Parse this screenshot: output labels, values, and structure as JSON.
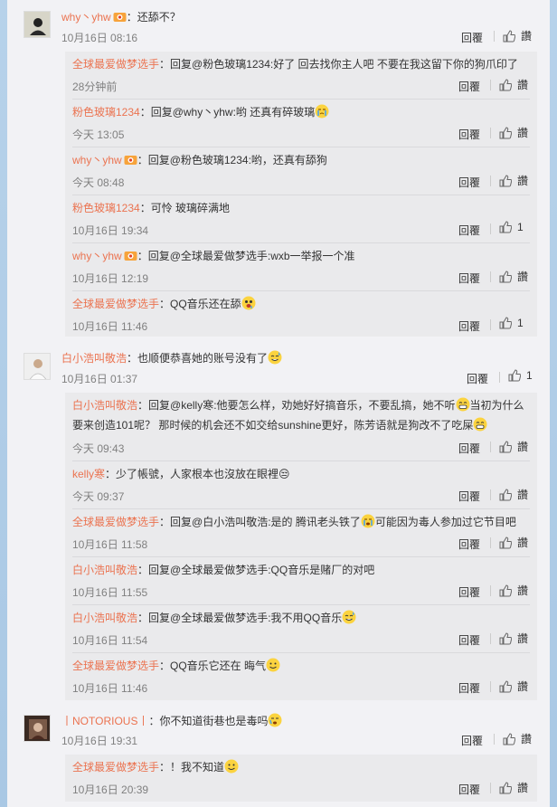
{
  "labels": {
    "reply": "回覆",
    "like": "讚"
  },
  "comments": [
    {
      "user": "why丶yhw",
      "text": "：还舔不？",
      "time": "10月16日 08:16",
      "replies": [
        {
          "user": "全球最爱做梦选手",
          "text": "：回复@粉色玻璃1234:好了 回去找你主人吧 不要在我这留下你的狗爪印了",
          "time": "28分钟前",
          "likes": ""
        },
        {
          "user": "粉色玻璃1234",
          "text": "：回复@why丶yhw:哟 还真有碎玻璃",
          "time": "今天 13:05",
          "likes": ""
        },
        {
          "user": "why丶yhw",
          "text": "：回复@粉色玻璃1234:哟，还真有舔狗",
          "time": "今天 08:48",
          "likes": ""
        },
        {
          "user": "粉色玻璃1234",
          "text": "：可怜 玻璃碎满地",
          "time": "10月16日 19:34",
          "likes": "1"
        },
        {
          "user": "why丶yhw",
          "text": "：回复@全球最爱做梦选手:wxb一举报一个准",
          "time": "10月16日 12:19",
          "likes": ""
        },
        {
          "user": "全球最爱做梦选手",
          "text": "：QQ音乐还在舔",
          "time": "10月16日 11:46",
          "likes": "1"
        }
      ]
    },
    {
      "user": "白小浩叫敬浩",
      "text": "：也顺便恭喜她的账号没有了",
      "time": "10月16日 01:37",
      "likes": "1",
      "replies": [
        {
          "user": "白小浩叫敬浩",
          "text": "：回复@kelly寒:他要怎么样，劝她好好搞音乐，不要乱搞，她不听",
          "text2": "当初为什么要来创造101呢？ 那时候的机会还不如交给sunshine更好，陈芳语就是狗改不了吃屎",
          "time": "今天 09:43",
          "likes": ""
        },
        {
          "user": "kelly寒",
          "text": "：少了帳號，人家根本也沒放在眼裡😒",
          "time": "今天 09:37",
          "likes": ""
        },
        {
          "user": "全球最爱做梦选手",
          "text": "：回复@白小浩叫敬浩:是的 腾讯老头铁了",
          "text2": "可能因为毒人参加过它节目吧",
          "time": "10月16日 11:58",
          "likes": ""
        },
        {
          "user": "白小浩叫敬浩",
          "text": "：回复@全球最爱做梦选手:QQ音乐是赌厂的对吧",
          "time": "10月16日 11:55",
          "likes": ""
        },
        {
          "user": "白小浩叫敬浩",
          "text": "：回复@全球最爱做梦选手:我不用QQ音乐",
          "time": "10月16日 11:54",
          "likes": ""
        },
        {
          "user": "全球最爱做梦选手",
          "text": "：QQ音乐它还在 晦气",
          "time": "10月16日 11:46",
          "likes": ""
        }
      ]
    },
    {
      "user": "丨NOTORIOUS丨",
      "text": "：你不知道街巷也是毒吗",
      "time": "10月16日 19:31",
      "replies": [
        {
          "user": "全球最爱做梦选手",
          "text": "：！我不知道",
          "time": "10月16日 20:39",
          "likes": ""
        }
      ]
    }
  ]
}
